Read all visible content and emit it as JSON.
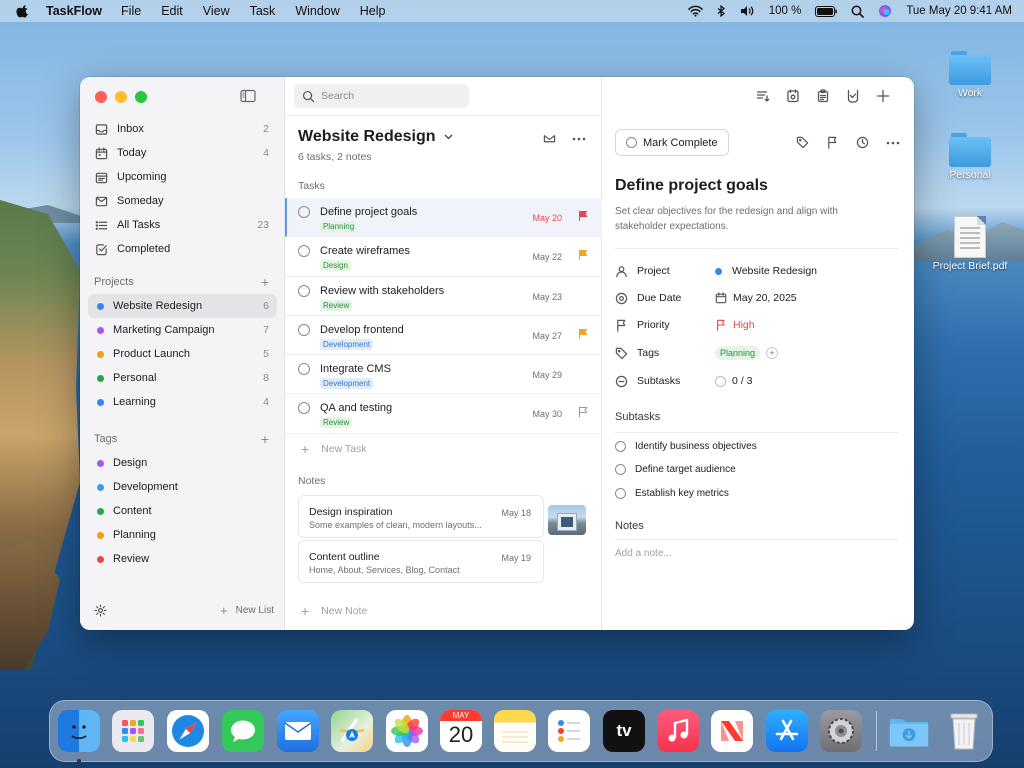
{
  "menubar": {
    "app_name": "TaskFlow",
    "menus": [
      "File",
      "Edit",
      "View",
      "Task",
      "Window",
      "Help"
    ],
    "battery": "100 %",
    "datetime": "Tue May 20  9:41 AM"
  },
  "desktop": {
    "icons": [
      {
        "label": "Work",
        "kind": "folder-icon"
      },
      {
        "label": "Personal",
        "kind": "folder-icon"
      },
      {
        "label": "Project Brief.pdf",
        "kind": "document-icon"
      }
    ]
  },
  "sidebar": {
    "nav": [
      {
        "label": "Inbox",
        "count": "2",
        "icon": "inbox-icon"
      },
      {
        "label": "Today",
        "count": "4",
        "icon": "calendar-icon"
      },
      {
        "label": "Upcoming",
        "count": "",
        "icon": "upcoming-icon"
      },
      {
        "label": "Someday",
        "count": "",
        "icon": "someday-icon"
      },
      {
        "label": "All Tasks",
        "count": "23",
        "icon": "list-icon"
      },
      {
        "label": "Completed",
        "count": "",
        "icon": "completed-icon"
      }
    ],
    "projects_label": "Projects",
    "projects": [
      {
        "label": "Website Redesign",
        "count": "6",
        "color": "#3b82f6"
      },
      {
        "label": "Marketing Campaign",
        "count": "7",
        "color": "#a855f7"
      },
      {
        "label": "Product Launch",
        "count": "5",
        "color": "#f59e0b"
      },
      {
        "label": "Personal",
        "count": "8",
        "color": "#22a845"
      },
      {
        "label": "Learning",
        "count": "4",
        "color": "#3b82f6"
      }
    ],
    "tags_label": "Tags",
    "tags": [
      {
        "label": "Design",
        "color": "#a855f7"
      },
      {
        "label": "Development",
        "color": "#3b9be5"
      },
      {
        "label": "Content",
        "color": "#22a845"
      },
      {
        "label": "Planning",
        "color": "#f59e0b"
      },
      {
        "label": "Review",
        "color": "#ef4444"
      }
    ],
    "new_list": "New List"
  },
  "list": {
    "search_placeholder": "Search",
    "title": "Website Redesign",
    "subtitle": "6 tasks, 2 notes",
    "tasks_label": "Tasks",
    "tasks": [
      {
        "name": "Define project goals",
        "tag": "Planning",
        "tag_class": "planning",
        "date": "May 20",
        "date_color": "#e5484d",
        "flag_color": "#e5484d",
        "selected": true
      },
      {
        "name": "Create wireframes",
        "tag": "Design",
        "tag_class": "design",
        "date": "May 22",
        "date_color": "#6e6e73",
        "flag_color": "#f5a524"
      },
      {
        "name": "Review with stakeholders",
        "tag": "Review",
        "tag_class": "review",
        "date": "May 23",
        "date_color": "#6e6e73",
        "flag_color": ""
      },
      {
        "name": "Develop frontend",
        "tag": "Development",
        "tag_class": "development",
        "date": "May 27",
        "date_color": "#6e6e73",
        "flag_color": "#f5a524"
      },
      {
        "name": "Integrate CMS",
        "tag": "Development",
        "tag_class": "development",
        "date": "May 29",
        "date_color": "#6e6e73",
        "flag_color": ""
      },
      {
        "name": "QA and testing",
        "tag": "Review",
        "tag_class": "review",
        "date": "May 30",
        "date_color": "#6e6e73",
        "flag_color": "outline"
      }
    ],
    "new_task": "New Task",
    "notes_label": "Notes",
    "notes": [
      {
        "title": "Design inspiration",
        "body": "Some examples of clean, modern layouts...",
        "date": "May 18"
      },
      {
        "title": "Content outline",
        "body": "Home, About, Services, Blog, Contact",
        "date": "May 19"
      }
    ],
    "new_note": "New Note"
  },
  "detail": {
    "mark_complete": "Mark Complete",
    "title": "Define project goals",
    "description": "Set clear objectives for the redesign and align with stakeholder expectations.",
    "properties": {
      "project_label": "Project",
      "project_value": "Website Redesign",
      "due_label": "Due Date",
      "due_value": "May 20, 2025",
      "priority_label": "Priority",
      "priority_value": "High",
      "tags_label": "Tags",
      "tags_value": "Planning",
      "subtasks_label": "Subtasks",
      "subtasks_value": "0 / 3"
    },
    "subtasks_label": "Subtasks",
    "subtasks": [
      "Identify business objectives",
      "Define target audience",
      "Establish key metrics"
    ],
    "notes_label": "Notes",
    "notes_placeholder": "Add a note..."
  },
  "dock": {
    "apps": [
      {
        "name": "finder-icon",
        "color": "#3a8ee6"
      },
      {
        "name": "launchpad-icon",
        "color": "#e8e8ee"
      },
      {
        "name": "safari-icon",
        "color": "#1e88e5"
      },
      {
        "name": "messages-icon",
        "color": "#34c759"
      },
      {
        "name": "mail-icon",
        "color": "#2f8df0"
      },
      {
        "name": "maps-icon",
        "color": "#6cc070"
      },
      {
        "name": "photos-icon",
        "color": "#ffffff"
      },
      {
        "name": "calendar-icon",
        "color": "#ffffff"
      },
      {
        "name": "notes-icon",
        "color": "#ffd84d"
      },
      {
        "name": "reminders-icon",
        "color": "#ffffff"
      },
      {
        "name": "tv-icon",
        "color": "#111111"
      },
      {
        "name": "music-icon",
        "color": "#fa3e57"
      },
      {
        "name": "news-icon",
        "color": "#ffffff"
      },
      {
        "name": "app-store-icon",
        "color": "#1a8cff"
      },
      {
        "name": "system-settings-icon",
        "color": "#8e8e93"
      }
    ],
    "calendar_month": "MAY",
    "calendar_day": "20",
    "tv_label": "tv"
  }
}
